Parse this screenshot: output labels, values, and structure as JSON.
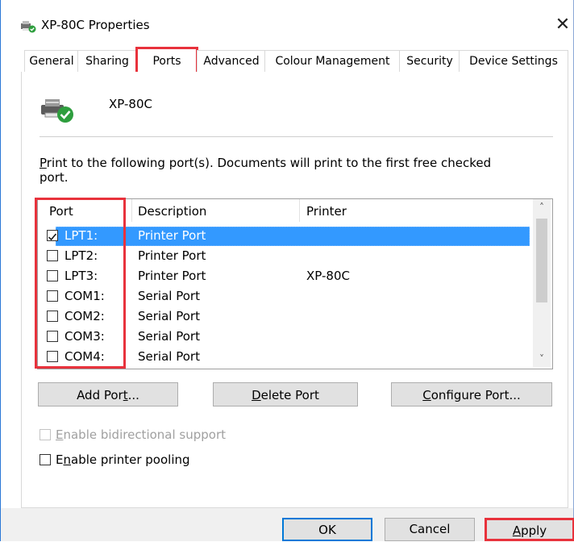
{
  "window": {
    "title": "XP-80C Properties",
    "close_glyph": "✕"
  },
  "tabs": [
    {
      "label": "General"
    },
    {
      "label": "Sharing"
    },
    {
      "label": "Ports"
    },
    {
      "label": "Advanced"
    },
    {
      "label": "Colour Management"
    },
    {
      "label": "Security"
    },
    {
      "label": "Device Settings"
    }
  ],
  "active_tab": "Ports",
  "printer": {
    "name": "XP-80C",
    "icon": "printer-ok-icon"
  },
  "instruction": {
    "first_letter": "P",
    "rest": "rint to the following port(s). Documents will print to the first free checked port."
  },
  "ports_list": {
    "columns": [
      "Port",
      "Description",
      "Printer"
    ],
    "rows": [
      {
        "port": "LPT1:",
        "description": "Printer Port",
        "printer": "",
        "checked": true,
        "selected": true
      },
      {
        "port": "LPT2:",
        "description": "Printer Port",
        "printer": "",
        "checked": false,
        "selected": false
      },
      {
        "port": "LPT3:",
        "description": "Printer Port",
        "printer": "XP-80C",
        "checked": false,
        "selected": false
      },
      {
        "port": "COM1:",
        "description": "Serial Port",
        "printer": "",
        "checked": false,
        "selected": false
      },
      {
        "port": "COM2:",
        "description": "Serial Port",
        "printer": "",
        "checked": false,
        "selected": false
      },
      {
        "port": "COM3:",
        "description": "Serial Port",
        "printer": "",
        "checked": false,
        "selected": false
      },
      {
        "port": "COM4:",
        "description": "Serial Port",
        "printer": "",
        "checked": false,
        "selected": false
      }
    ],
    "scroll_up_glyph": "˄",
    "scroll_down_glyph": "˅"
  },
  "port_buttons": {
    "add_pre": "Add Por",
    "add_key": "t",
    "add_post": "...",
    "delete_key": "D",
    "delete_post": "elete Port",
    "configure_key": "C",
    "configure_post": "onfigure Port..."
  },
  "options": {
    "bidirectional_key": "E",
    "bidirectional_rest": "nable bidirectional support",
    "bidirectional_checked": false,
    "bidirectional_enabled": false,
    "pooling_key": "n",
    "pooling_pre": "E",
    "pooling_rest": "able printer pooling",
    "pooling_checked": false
  },
  "footer": {
    "ok": "OK",
    "cancel": "Cancel",
    "apply_key": "A",
    "apply_rest": "pply"
  },
  "colors": {
    "highlight_red": "#e8323c",
    "selection_blue": "#3399ff",
    "accent_blue": "#0078d7"
  }
}
